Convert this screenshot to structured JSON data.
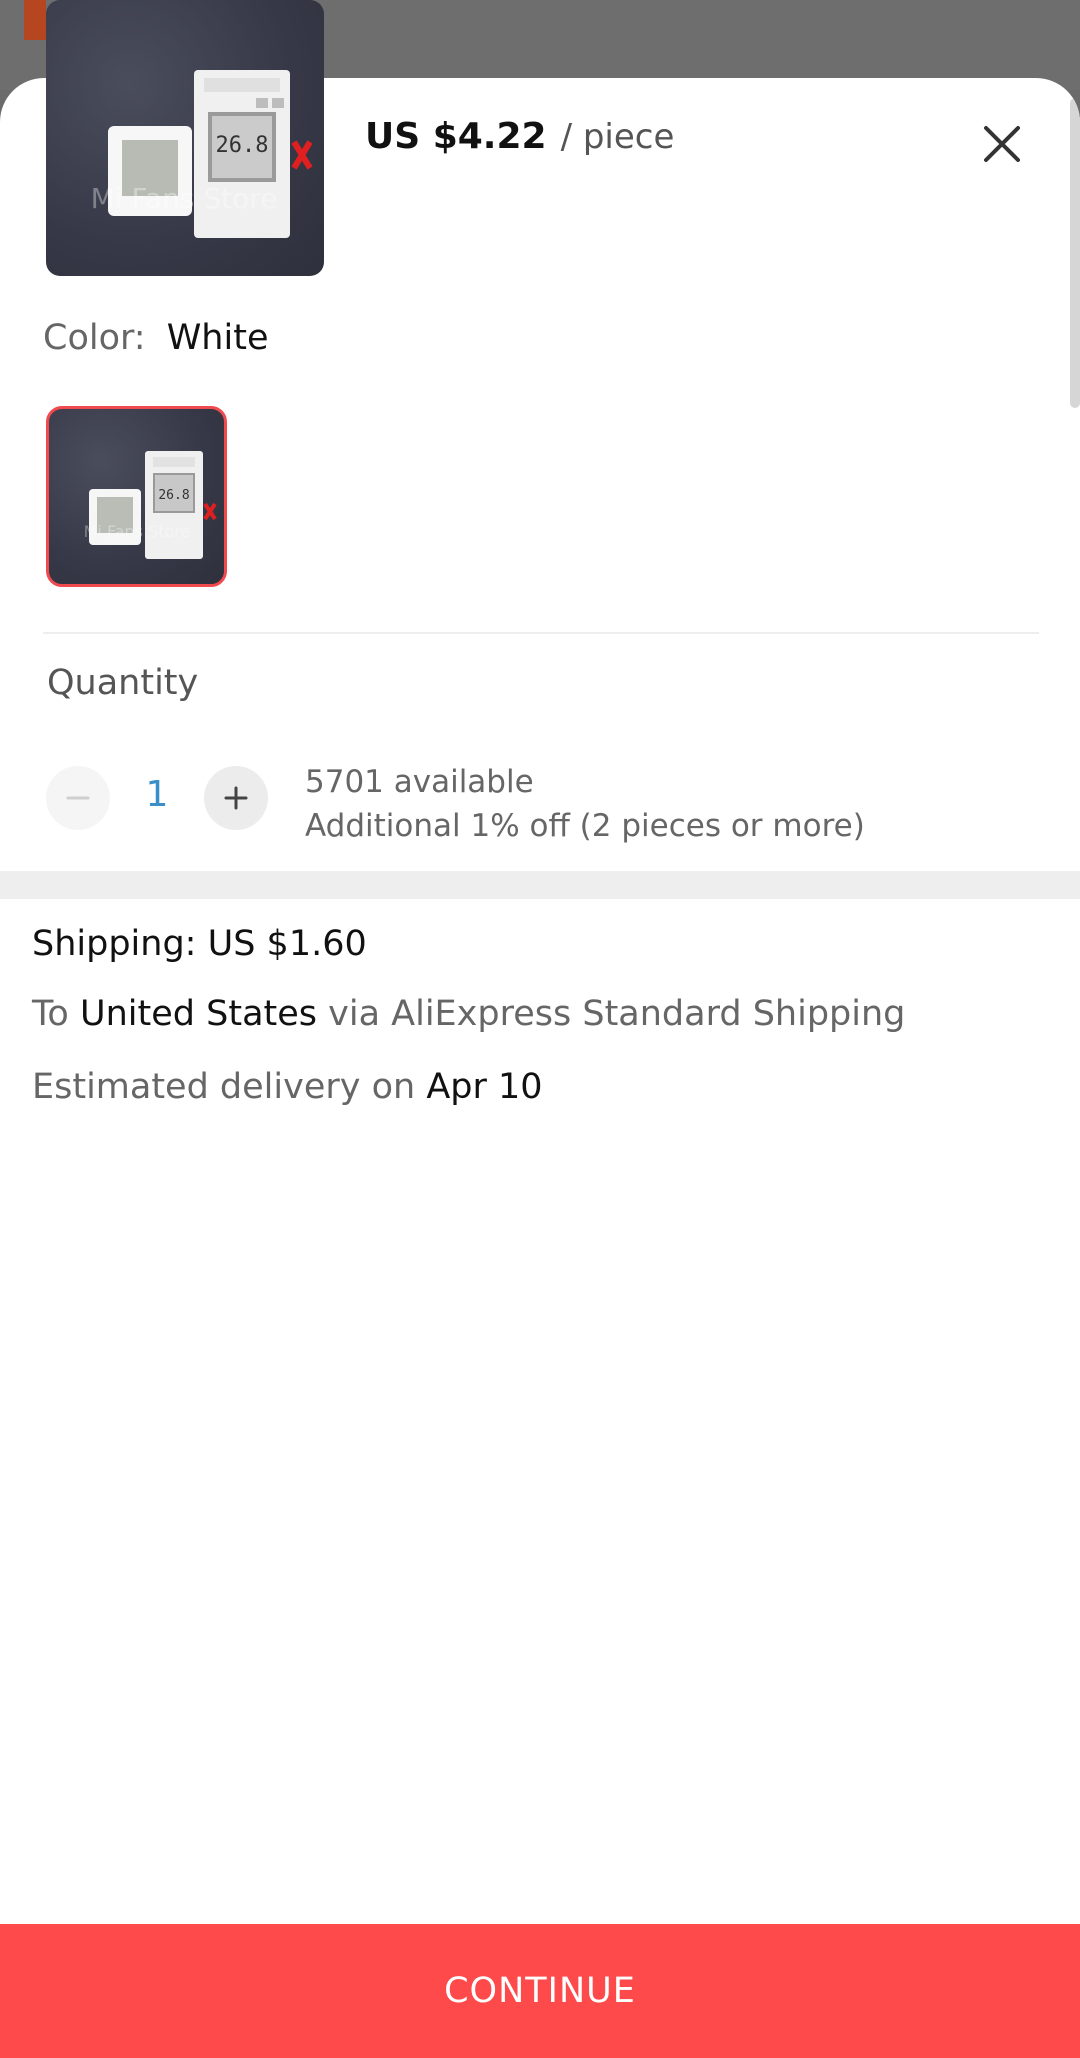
{
  "product": {
    "price": "US $4.22",
    "unit": "/ piece",
    "image_icon": "thermometer-product-photo",
    "watermark": "Mi Fans Store",
    "device_reading": "26.8"
  },
  "variant": {
    "label": "Color:",
    "selected": "White"
  },
  "quantity": {
    "title": "Quantity",
    "value": "1",
    "available": "5701 available",
    "discount": "Additional 1% off (2 pieces or more)"
  },
  "shipping": {
    "label": "Shipping: US $1.60",
    "to_prefix": "To",
    "country": "United States",
    "via": "via AliExpress Standard Shipping",
    "delivery_prefix": "Estimated delivery on",
    "delivery_date": "Apr 10"
  },
  "actions": {
    "continue_label": "CONTINUE"
  },
  "colors": {
    "accent": "#fe4a4a",
    "selected_border": "#f04a4e",
    "quantity_text": "#3a8fc8"
  }
}
